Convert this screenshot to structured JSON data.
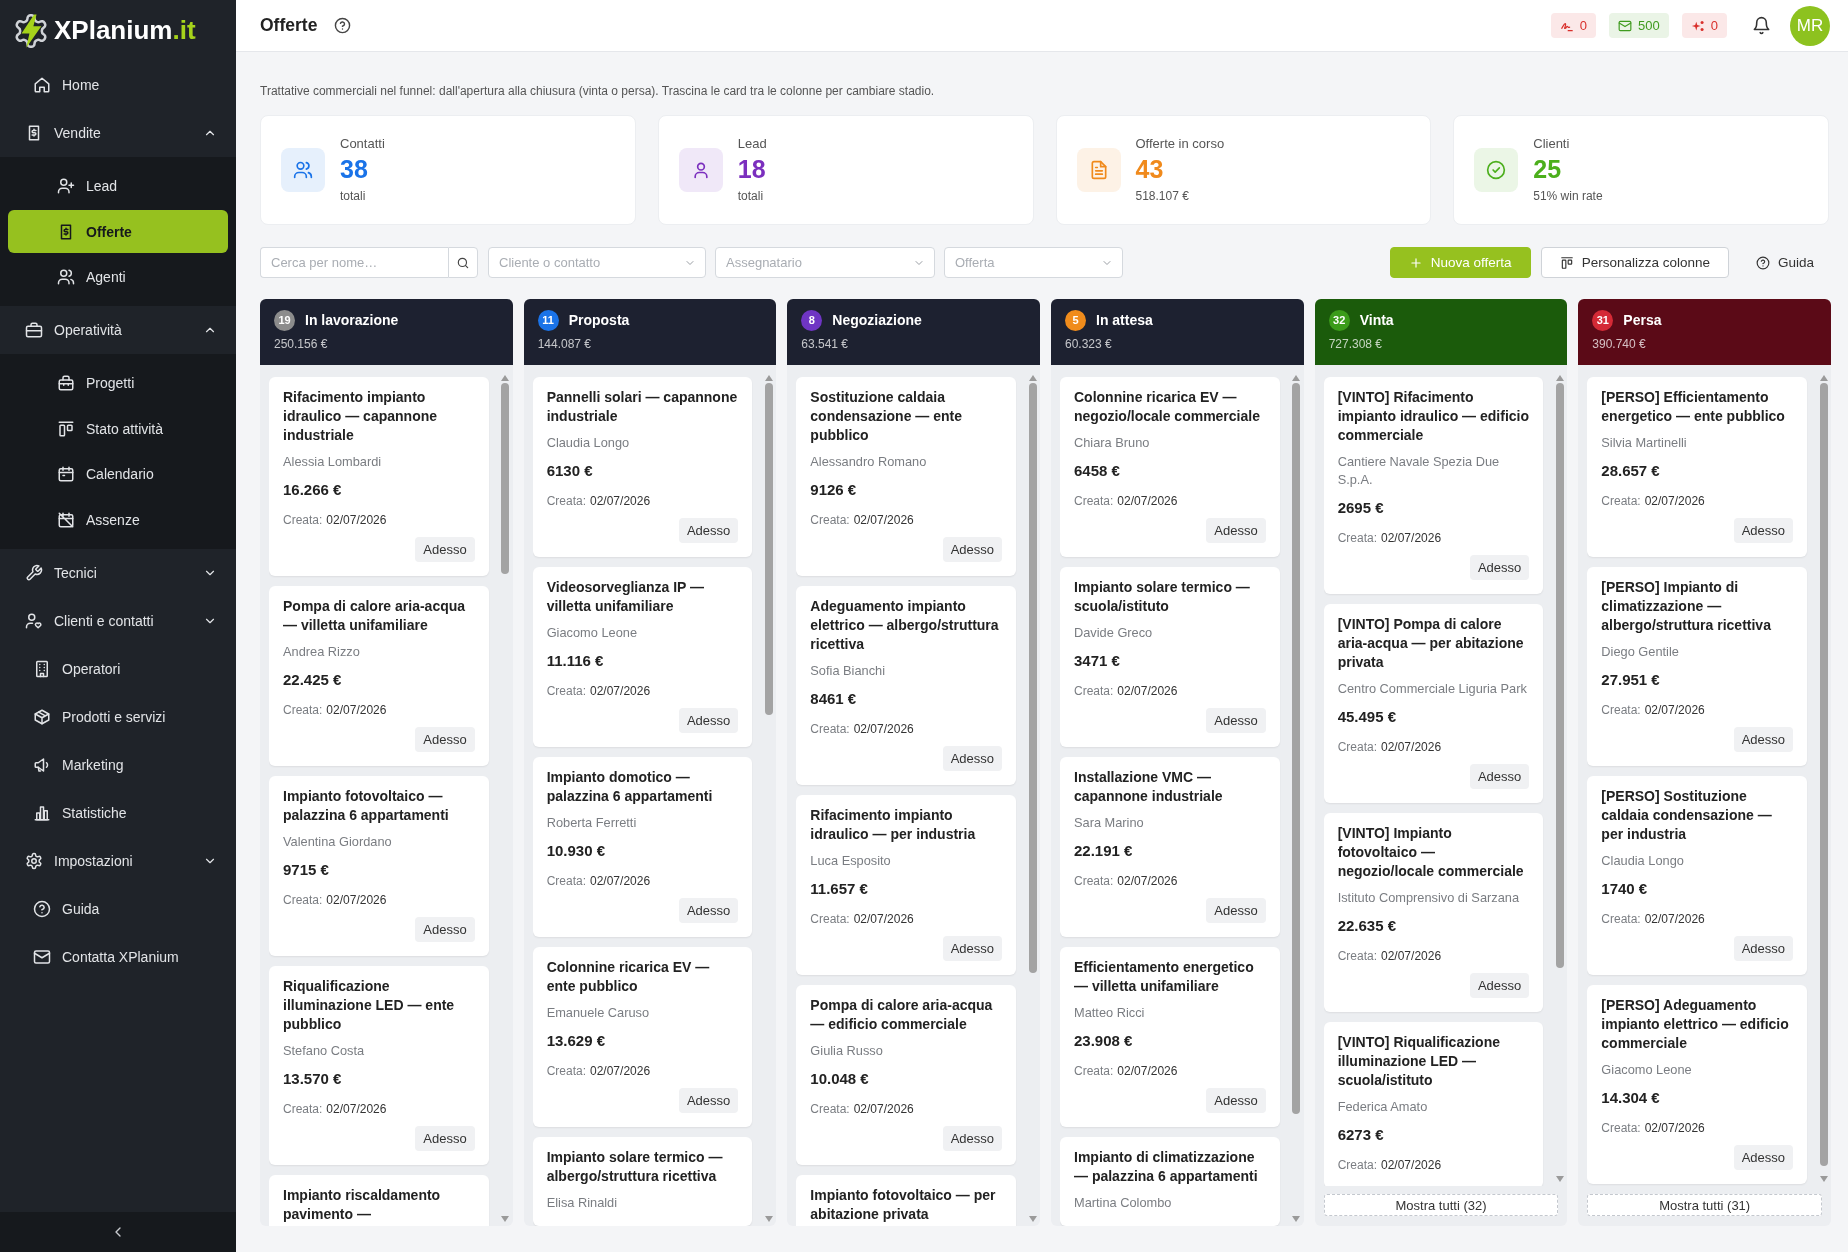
{
  "sidebar": {
    "logo": {
      "name": "XPlanium",
      "suffix": ".it"
    },
    "items": [
      {
        "label": "Home",
        "kind": "link",
        "selected": false
      },
      {
        "label": "Vendite",
        "kind": "group",
        "selected": false,
        "expanded": true,
        "children": [
          {
            "label": "Lead",
            "selected": false
          },
          {
            "label": "Offerte",
            "selected": true
          },
          {
            "label": "Agenti",
            "selected": false
          }
        ]
      },
      {
        "label": "Operatività",
        "kind": "group",
        "selected": false,
        "expanded": true,
        "children": [
          {
            "label": "Progetti",
            "selected": false
          },
          {
            "label": "Stato attività",
            "selected": false
          },
          {
            "label": "Calendario",
            "selected": false
          },
          {
            "label": "Assenze",
            "selected": false
          }
        ]
      },
      {
        "label": "Tecnici",
        "kind": "group",
        "selected": false,
        "expanded": false
      },
      {
        "label": "Clienti e contatti",
        "kind": "group",
        "selected": false,
        "expanded": false
      },
      {
        "label": "Operatori",
        "kind": "link",
        "selected": false
      },
      {
        "label": "Prodotti e servizi",
        "kind": "link",
        "selected": false
      },
      {
        "label": "Marketing",
        "kind": "link",
        "selected": false
      },
      {
        "label": "Statistiche",
        "kind": "link",
        "selected": false
      },
      {
        "label": "Impostazioni",
        "kind": "group",
        "selected": false,
        "expanded": false
      },
      {
        "label": "Guida",
        "kind": "link",
        "selected": false
      },
      {
        "label": "Contatta XPlanium",
        "kind": "link",
        "selected": false
      }
    ]
  },
  "header": {
    "title": "Offerte",
    "counters": [
      {
        "value": "0",
        "color": "#d9302c"
      },
      {
        "value": "500",
        "color": "#3f9b1f"
      },
      {
        "value": "0",
        "color": "#d9302c"
      }
    ],
    "avatar": "MR"
  },
  "description": "Trattative commerciali nel funnel: dall'apertura alla chiusura (vinta o persa). Trascina le card tra le colonne per cambiare stadio.",
  "stats": [
    {
      "label": "Contatti",
      "value": "38",
      "caption": "totali",
      "color": "#1a73e8"
    },
    {
      "label": "Lead",
      "value": "18",
      "caption": "totali",
      "color": "#7b2fbe"
    },
    {
      "label": "Offerte in corso",
      "value": "43",
      "caption": "518.107 €",
      "color": "#f08a1c"
    },
    {
      "label": "Clienti",
      "value": "25",
      "caption": "51% win rate",
      "color": "#4caf1c"
    }
  ],
  "filters": {
    "search": {
      "placeholder": "Cerca per nome…"
    },
    "selects": [
      {
        "placeholder": "Cliente o contatto"
      },
      {
        "placeholder": "Assegnatario"
      },
      {
        "placeholder": "Offerta"
      }
    ],
    "actions": [
      {
        "label": "Nuova offerta",
        "kind": "primary"
      },
      {
        "label": "Personalizza colonne",
        "kind": "secondary"
      },
      {
        "label": "Guida",
        "kind": "link"
      }
    ]
  },
  "columns": [
    {
      "title": "In lavorazione",
      "count": "19",
      "total": "250.156 €",
      "kind": "open",
      "color": "#8c8c8c",
      "cards": [
        {
          "title": "Rifacimento impianto idraulico — capannone industriale",
          "contact": "Alessia Lombardi",
          "amount": "16.266 €",
          "created_label": "Creata:",
          "created": "02/07/2026",
          "action": "Adesso"
        },
        {
          "title": "Pompa di calore aria-acqua — villetta unifamiliare",
          "contact": "Andrea Rizzo",
          "amount": "22.425 €",
          "created_label": "Creata:",
          "created": "02/07/2026",
          "action": "Adesso"
        },
        {
          "title": "Impianto fotovoltaico — palazzina 6 appartamenti",
          "contact": "Valentina Giordano",
          "amount": "9715 €",
          "created_label": "Creata:",
          "created": "02/07/2026",
          "action": "Adesso"
        },
        {
          "title": "Riqualificazione illuminazione LED — ente pubblico",
          "contact": "Stefano Costa",
          "amount": "13.570 €",
          "created_label": "Creata:",
          "created": "02/07/2026",
          "action": "Adesso"
        },
        {
          "title": "Impianto riscaldamento pavimento —"
        }
      ]
    },
    {
      "title": "Proposta",
      "count": "11",
      "total": "144.087 €",
      "kind": "open",
      "color": "#1a73e8",
      "cards": [
        {
          "title": "Pannelli solari — capannone industriale",
          "contact": "Claudia Longo",
          "amount": "6130 €",
          "created_label": "Creata:",
          "created": "02/07/2026",
          "action": "Adesso"
        },
        {
          "title": "Videosorveglianza IP — villetta unifamiliare",
          "contact": "Giacomo Leone",
          "amount": "11.116 €",
          "created_label": "Creata:",
          "created": "02/07/2026",
          "action": "Adesso"
        },
        {
          "title": "Impianto domotico — palazzina 6 appartamenti",
          "contact": "Roberta Ferretti",
          "amount": "10.930 €",
          "created_label": "Creata:",
          "created": "02/07/2026",
          "action": "Adesso"
        },
        {
          "title": "Colonnine ricarica EV — ente pubblico",
          "contact": "Emanuele Caruso",
          "amount": "13.629 €",
          "created_label": "Creata:",
          "created": "02/07/2026",
          "action": "Adesso"
        },
        {
          "title": "Impianto solare termico — albergo/struttura ricettiva",
          "contact": "Elisa Rinaldi"
        }
      ]
    },
    {
      "title": "Negoziazione",
      "count": "8",
      "total": "63.541 €",
      "kind": "open",
      "color": "#6f35c4",
      "cards": [
        {
          "title": "Sostituzione caldaia condensazione — ente pubblico",
          "contact": "Alessandro Romano",
          "amount": "9126 €",
          "created_label": "Creata:",
          "created": "02/07/2026",
          "action": "Adesso"
        },
        {
          "title": "Adeguamento impianto elettrico — albergo/struttura ricettiva",
          "contact": "Sofia Bianchi",
          "amount": "8461 €",
          "created_label": "Creata:",
          "created": "02/07/2026",
          "action": "Adesso"
        },
        {
          "title": "Rifacimento impianto idraulico — per industria",
          "contact": "Luca Esposito",
          "amount": "11.657 €",
          "created_label": "Creata:",
          "created": "02/07/2026",
          "action": "Adesso"
        },
        {
          "title": "Pompa di calore aria-acqua — edificio commerciale",
          "contact": "Giulia Russo",
          "amount": "10.048 €",
          "created_label": "Creata:",
          "created": "02/07/2026",
          "action": "Adesso"
        },
        {
          "title": "Impianto fotovoltaico — per abitazione privata"
        }
      ]
    },
    {
      "title": "In attesa",
      "count": "5",
      "total": "60.323 €",
      "kind": "open",
      "color": "#f08c1c",
      "cards": [
        {
          "title": "Colonnine ricarica EV — negozio/locale commerciale",
          "contact": "Chiara Bruno",
          "amount": "6458 €",
          "created_label": "Creata:",
          "created": "02/07/2026",
          "action": "Adesso"
        },
        {
          "title": "Impianto solare termico — scuola/istituto",
          "contact": "Davide Greco",
          "amount": "3471 €",
          "created_label": "Creata:",
          "created": "02/07/2026",
          "action": "Adesso"
        },
        {
          "title": "Installazione VMC — capannone industriale",
          "contact": "Sara Marino",
          "amount": "22.191 €",
          "created_label": "Creata:",
          "created": "02/07/2026",
          "action": "Adesso"
        },
        {
          "title": "Efficientamento energetico — villetta unifamiliare",
          "contact": "Matteo Ricci",
          "amount": "23.908 €",
          "created_label": "Creata:",
          "created": "02/07/2026",
          "action": "Adesso"
        },
        {
          "title": "Impianto di climatizzazione — palazzina 6 appartamenti",
          "contact": "Martina Colombo"
        }
      ]
    },
    {
      "title": "Vinta",
      "count": "32",
      "total": "727.308 €",
      "kind": "won",
      "color": "#3b9c1a",
      "show_all": "Mostra tutti (32)",
      "cards": [
        {
          "title": "[VINTO] Rifacimento impianto idraulico — edificio commerciale",
          "contact": "Cantiere Navale Spezia Due S.p.A.",
          "amount": "2695 €",
          "created_label": "Creata:",
          "created": "02/07/2026",
          "action": "Adesso"
        },
        {
          "title": "[VINTO] Pompa di calore aria-acqua — per abitazione privata",
          "contact": "Centro Commerciale Liguria Park",
          "amount": "45.495 €",
          "created_label": "Creata:",
          "created": "02/07/2026",
          "action": "Adesso"
        },
        {
          "title": "[VINTO] Impianto fotovoltaico — negozio/locale commerciale",
          "contact": "Istituto Comprensivo di Sarzana",
          "amount": "22.635 €",
          "created_label": "Creata:",
          "created": "02/07/2026",
          "action": "Adesso"
        },
        {
          "title": "[VINTO] Riqualificazione illuminazione LED — scuola/istituto",
          "contact": "Federica Amato",
          "amount": "6273 €",
          "created_label": "Creata:",
          "created": "02/07/2026"
        }
      ]
    },
    {
      "title": "Persa",
      "count": "31",
      "total": "390.740 €",
      "kind": "lost",
      "color": "#d42a36",
      "show_all": "Mostra tutti (31)",
      "cards": [
        {
          "title": "[PERSO] Efficientamento energetico — ente pubblico",
          "contact": "Silvia Martinelli",
          "amount": "28.657 €",
          "created_label": "Creata:",
          "created": "02/07/2026",
          "action": "Adesso"
        },
        {
          "title": "[PERSO] Impianto di climatizzazione — albergo/struttura ricettiva",
          "contact": "Diego Gentile",
          "amount": "27.951 €",
          "created_label": "Creata:",
          "created": "02/07/2026",
          "action": "Adesso"
        },
        {
          "title": "[PERSO] Sostituzione caldaia condensazione — per industria",
          "contact": "Claudia Longo",
          "amount": "1740 €",
          "created_label": "Creata:",
          "created": "02/07/2026",
          "action": "Adesso"
        },
        {
          "title": "[PERSO] Adeguamento impianto elettrico — edificio commerciale",
          "contact": "Giacomo Leone",
          "amount": "14.304 €",
          "created_label": "Creata:",
          "created": "02/07/2026",
          "action": "Adesso"
        }
      ]
    }
  ]
}
